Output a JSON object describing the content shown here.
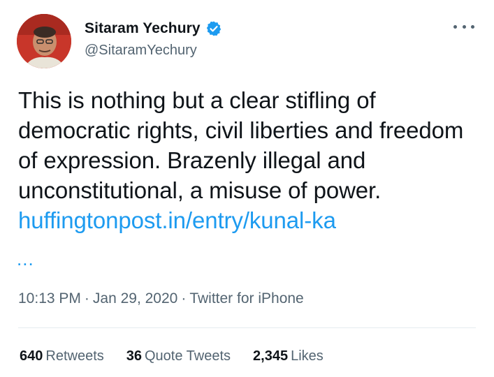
{
  "author": {
    "display_name": "Sitaram Yechury",
    "handle": "@SitaramYechury",
    "verified_icon": "verified-badge-icon"
  },
  "tweet": {
    "text": "This is nothing but a clear stifling of democratic rights, civil liberties and freedom of expression. Brazenly illegal and unconstitutional, a misuse of power.",
    "link_text": "huffingtonpost.in/entry/kunal-ka",
    "link_ellipsis": "...",
    "time": "10:13 PM",
    "date": "Jan 29, 2020",
    "source": "Twitter for iPhone",
    "separator": "·"
  },
  "stats": {
    "retweets_count": "640",
    "retweets_label": "Retweets",
    "quotes_count": "36",
    "quotes_label": "Quote Tweets",
    "likes_count": "2,345",
    "likes_label": "Likes"
  },
  "colors": {
    "link": "#1d9bf0",
    "secondary_text": "#536471",
    "primary_text": "#0f1419"
  }
}
